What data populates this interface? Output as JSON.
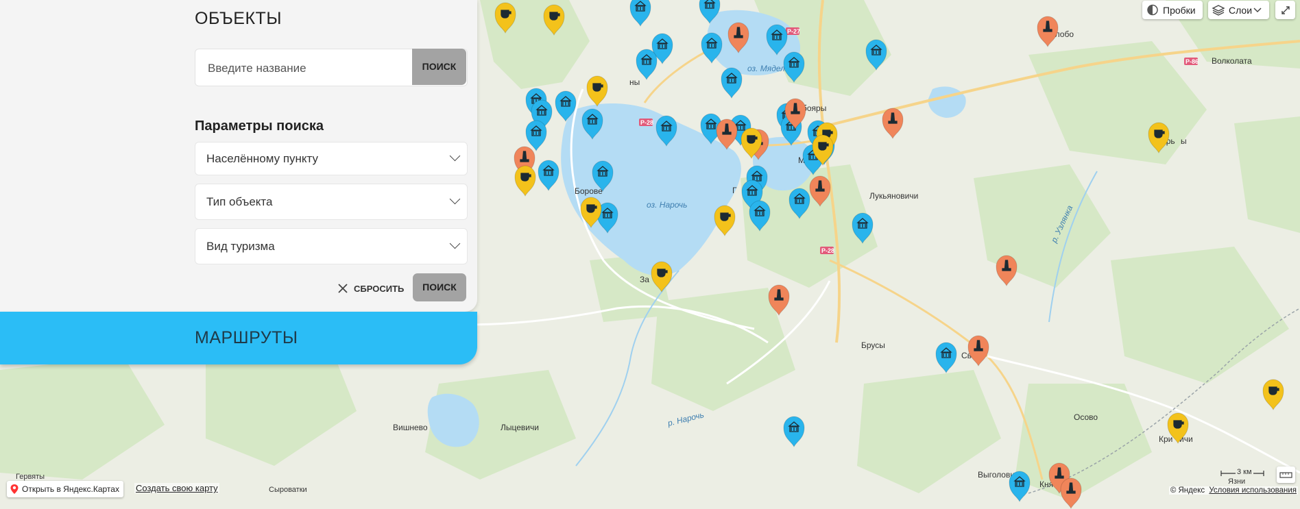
{
  "panel": {
    "objects_title": "ОБЪЕКТЫ",
    "search_placeholder": "Введите название",
    "search_button": "ПОИСК",
    "params_title": "Параметры поиска",
    "selects": [
      "Населённому пункту",
      "Тип объекта",
      "Вид туризма"
    ],
    "reset_label": "СБРОСИТЬ",
    "submit_label": "ПОИСК",
    "routes_title": "МАРШРУТЫ"
  },
  "map_controls": {
    "traffic_label": "Пробки",
    "layers_label": "Слои",
    "open_in_maps": "Открыть в Яндекс.Картах",
    "create_map": "Создать свою карту",
    "copyright": "© Яндекс",
    "terms": "Условия использования",
    "scale_label": "3 км"
  },
  "map_labels": {
    "lake_myadel": "оз. Мядель",
    "lake_naroch": "оз. Нарочь",
    "river_naroch": "р. Нарочь",
    "river_uzlyanka": "р. Узлянка",
    "road_p27": "Р-27",
    "road_p86": "Р-86",
    "road_p28a": "Р-28",
    "road_p28b": "Р-28",
    "slobodka": "Слобо",
    "volkolata": "Волколата",
    "staroe": "Старь",
    "staroe_end": "ы",
    "lukyanovichi": "Лукьяновичи",
    "borove": "Борове",
    "brusy": "Брусы",
    "svatki": "Сват",
    "osovo": "Осово",
    "vishnevo": "Вишнево",
    "lytsevichi": "Лыцевичи",
    "gervyaty": "Гервяты",
    "syrovatki": "Сыроватки",
    "vygolovichi": "Выголови",
    "kniaz": "Кня",
    "krivichi": "Кри",
    "krivichi_end": "ичи",
    "yazni": "Язни",
    "myadel": "Мя",
    "boyary": "бояры",
    "zanaroch": "За",
    "gatovichi": "Г",
    "ny": "ны"
  },
  "colors": {
    "blue_marker": "#29b4ec",
    "orange_marker": "#f0855a",
    "yellow_marker": "#f3c21b",
    "lake": "#b4dcf4",
    "routes_bar": "#2bbdf6"
  },
  "markers": [
    {
      "color": "blue",
      "icon": "museum"
    },
    {
      "color": "blue",
      "icon": "museum"
    },
    {
      "color": "blue",
      "icon": "museum"
    },
    {
      "color": "blue",
      "icon": "museum"
    },
    {
      "color": "blue",
      "icon": "museum"
    },
    {
      "color": "blue",
      "icon": "museum"
    },
    {
      "color": "blue",
      "icon": "museum"
    },
    {
      "color": "blue",
      "icon": "museum"
    },
    {
      "color": "blue",
      "icon": "museum"
    },
    {
      "color": "blue",
      "icon": "museum"
    },
    {
      "color": "blue",
      "icon": "museum"
    },
    {
      "color": "blue",
      "icon": "museum"
    },
    {
      "color": "blue",
      "icon": "museum"
    },
    {
      "color": "blue",
      "icon": "museum"
    },
    {
      "color": "blue",
      "icon": "museum"
    },
    {
      "color": "blue",
      "icon": "museum"
    },
    {
      "color": "blue",
      "icon": "museum"
    },
    {
      "color": "blue",
      "icon": "museum"
    },
    {
      "color": "blue",
      "icon": "museum"
    },
    {
      "color": "blue",
      "icon": "museum"
    },
    {
      "color": "blue",
      "icon": "museum"
    },
    {
      "color": "blue",
      "icon": "museum"
    },
    {
      "color": "blue",
      "icon": "museum"
    },
    {
      "color": "blue",
      "icon": "museum"
    },
    {
      "color": "blue",
      "icon": "museum"
    },
    {
      "color": "blue",
      "icon": "museum"
    },
    {
      "color": "blue",
      "icon": "museum"
    },
    {
      "color": "blue",
      "icon": "museum"
    },
    {
      "color": "blue",
      "icon": "museum"
    },
    {
      "color": "blue",
      "icon": "museum"
    },
    {
      "color": "blue",
      "icon": "museum"
    },
    {
      "color": "blue",
      "icon": "museum"
    },
    {
      "color": "blue",
      "icon": "museum"
    },
    {
      "color": "orange",
      "icon": "monument"
    },
    {
      "color": "orange",
      "icon": "monument"
    },
    {
      "color": "orange",
      "icon": "monument"
    },
    {
      "color": "orange",
      "icon": "monument"
    },
    {
      "color": "orange",
      "icon": "monument"
    },
    {
      "color": "orange",
      "icon": "monument"
    },
    {
      "color": "orange",
      "icon": "monument"
    },
    {
      "color": "orange",
      "icon": "monument"
    },
    {
      "color": "orange",
      "icon": "monument"
    },
    {
      "color": "orange",
      "icon": "monument"
    },
    {
      "color": "orange",
      "icon": "monument"
    },
    {
      "color": "orange",
      "icon": "monument"
    },
    {
      "color": "orange",
      "icon": "monument"
    },
    {
      "color": "yellow",
      "icon": "cafe"
    },
    {
      "color": "yellow",
      "icon": "cafe"
    },
    {
      "color": "yellow",
      "icon": "cafe"
    },
    {
      "color": "yellow",
      "icon": "cafe"
    },
    {
      "color": "yellow",
      "icon": "cafe"
    },
    {
      "color": "yellow",
      "icon": "cafe"
    },
    {
      "color": "yellow",
      "icon": "cafe"
    },
    {
      "color": "yellow",
      "icon": "cafe"
    },
    {
      "color": "yellow",
      "icon": "cafe"
    },
    {
      "color": "yellow",
      "icon": "cafe"
    },
    {
      "color": "yellow",
      "icon": "cafe"
    },
    {
      "color": "yellow",
      "icon": "cafe"
    },
    {
      "color": "yellow",
      "icon": "cafe"
    }
  ]
}
